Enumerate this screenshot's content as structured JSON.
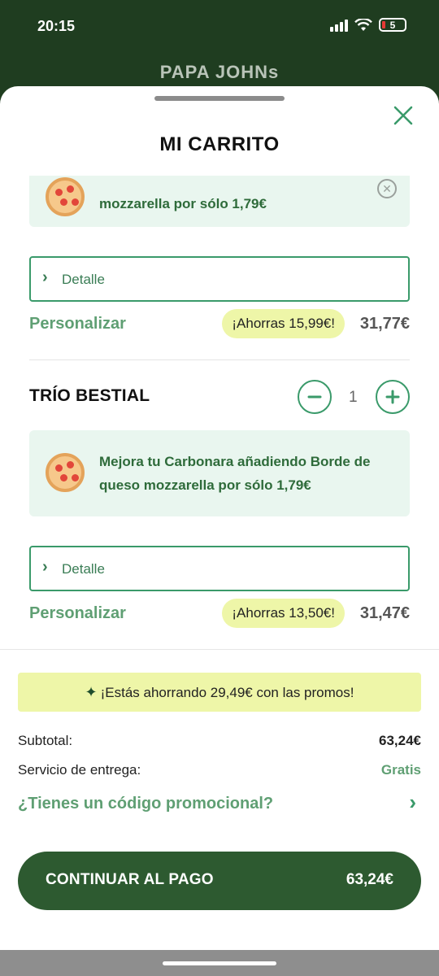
{
  "status_bar": {
    "time": "20:15",
    "battery": "5"
  },
  "header": {
    "brand": "PAPA JOHNs"
  },
  "sheet": {
    "title": "MI CARRITO"
  },
  "items": [
    {
      "promo_text": "mozzarella por sólo 1,79€",
      "detail_label": "Detalle",
      "personalize_label": "Personalizar",
      "savings": "¡Ahorras  15,99€!",
      "price": "31,77€"
    },
    {
      "title": "TRÍO BESTIAL",
      "quantity": "1",
      "promo_text": "Mejora tu Carbonara añadiendo Borde de queso mozzarella por sólo 1,79€",
      "detail_label": "Detalle",
      "personalize_label": "Personalizar",
      "savings": "¡Ahorras  13,50€!",
      "price": "31,47€"
    }
  ],
  "summary": {
    "banner": "¡Estás ahorrando 29,49€ con las promos!",
    "subtotal_label": "Subtotal:",
    "subtotal_value": "63,24€",
    "delivery_label": "Servicio de entrega:",
    "delivery_value": "Gratis",
    "promo_code_label": "¿Tienes un código promocional?"
  },
  "checkout": {
    "label": "CONTINUAR AL PAGO",
    "amount": "63,24€"
  },
  "colors": {
    "brand_green": "#2d5a30",
    "accent_green": "#3a9a6a",
    "promo_bg": "#e9f6ef",
    "savings_bg": "#eef6a8"
  }
}
